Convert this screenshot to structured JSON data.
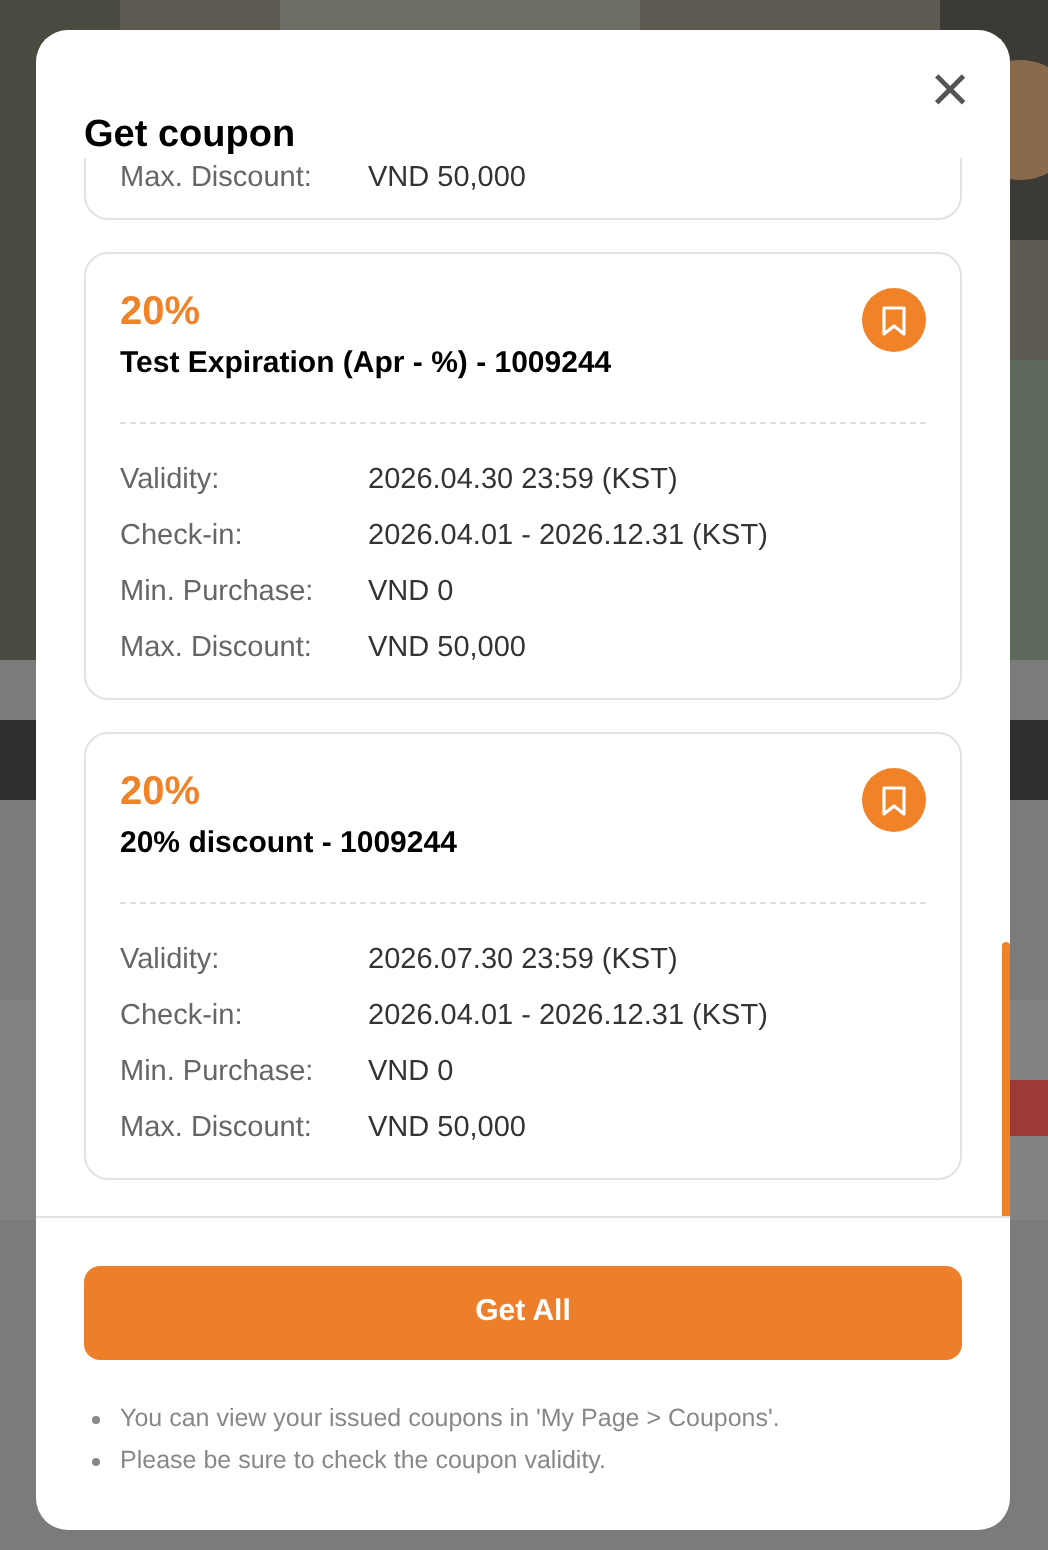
{
  "dialog": {
    "title": "Get coupon",
    "close_label": "×"
  },
  "coupons": [
    {
      "kind": "partial",
      "details": [
        {
          "label": "Max. Discount:",
          "value": "VND 50,000"
        }
      ]
    },
    {
      "kind": "full",
      "percent": "20%",
      "name": "Test Expiration (Apr - %) - 1009244",
      "details": [
        {
          "label": "Validity:",
          "value": "2026.04.30 23:59 (KST)"
        },
        {
          "label": "Check-in:",
          "value": "2026.04.01 - 2026.12.31 (KST)"
        },
        {
          "label": "Min. Purchase:",
          "value": "VND 0"
        },
        {
          "label": "Max. Discount:",
          "value": "VND 50,000"
        }
      ]
    },
    {
      "kind": "full",
      "percent": "20%",
      "name": "20% discount - 1009244",
      "details": [
        {
          "label": "Validity:",
          "value": "2026.07.30 23:59 (KST)"
        },
        {
          "label": "Check-in:",
          "value": "2026.04.01 - 2026.12.31 (KST)"
        },
        {
          "label": "Min. Purchase:",
          "value": "VND 0"
        },
        {
          "label": "Max. Discount:",
          "value": "VND 50,000"
        }
      ]
    }
  ],
  "primary_button": "Get All",
  "notes": [
    "You can view your issued coupons in 'My Page > Coupons'.",
    "Please be sure to check the coupon validity."
  ]
}
